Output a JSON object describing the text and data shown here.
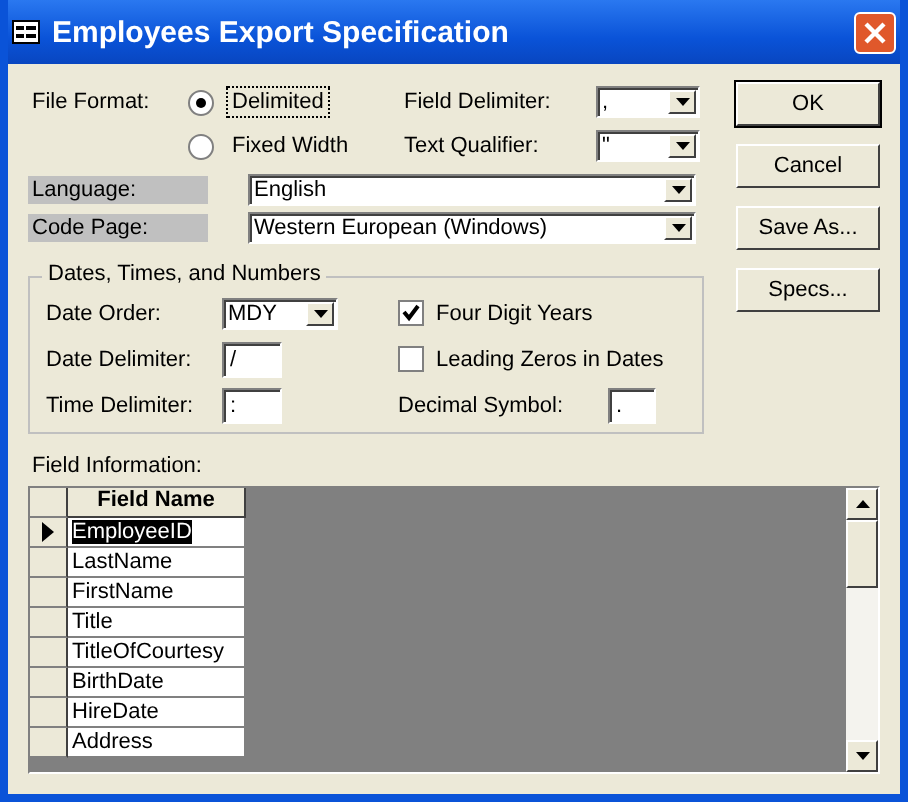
{
  "window": {
    "title": "Employees Export Specification"
  },
  "file_format": {
    "label": "File Format:",
    "options": [
      {
        "label": "Delimited",
        "selected": true,
        "focused": true
      },
      {
        "label": "Fixed Width",
        "selected": false,
        "focused": false
      }
    ]
  },
  "field_delimiter": {
    "label": "Field Delimiter:",
    "value": ","
  },
  "text_qualifier": {
    "label": "Text Qualifier:",
    "value": "\""
  },
  "language": {
    "label": "Language:",
    "value": "English"
  },
  "code_page": {
    "label": "Code Page:",
    "value": "Western European (Windows)"
  },
  "dates_group": {
    "title": "Dates, Times, and Numbers",
    "date_order": {
      "label": "Date Order:",
      "value": "MDY"
    },
    "date_delimiter": {
      "label": "Date Delimiter:",
      "value": "/"
    },
    "time_delimiter": {
      "label": "Time Delimiter:",
      "value": ":"
    },
    "four_digit_years": {
      "label": "Four Digit Years",
      "checked": true
    },
    "leading_zeros": {
      "label": "Leading Zeros in Dates",
      "checked": false
    },
    "decimal_symbol": {
      "label": "Decimal Symbol:",
      "value": "."
    }
  },
  "buttons": [
    {
      "label": "OK"
    },
    {
      "label": "Cancel"
    },
    {
      "label": "Save As..."
    },
    {
      "label": "Specs..."
    }
  ],
  "field_information": {
    "label": "Field Information:",
    "columns": [
      "Field Name"
    ],
    "rows": [
      {
        "field_name": "EmployeeID",
        "selected": true
      },
      {
        "field_name": "LastName",
        "selected": false
      },
      {
        "field_name": "FirstName",
        "selected": false
      },
      {
        "field_name": "Title",
        "selected": false
      },
      {
        "field_name": "TitleOfCourtesy",
        "selected": false
      },
      {
        "field_name": "BirthDate",
        "selected": false
      },
      {
        "field_name": "HireDate",
        "selected": false
      },
      {
        "field_name": "Address",
        "selected": false
      }
    ]
  }
}
